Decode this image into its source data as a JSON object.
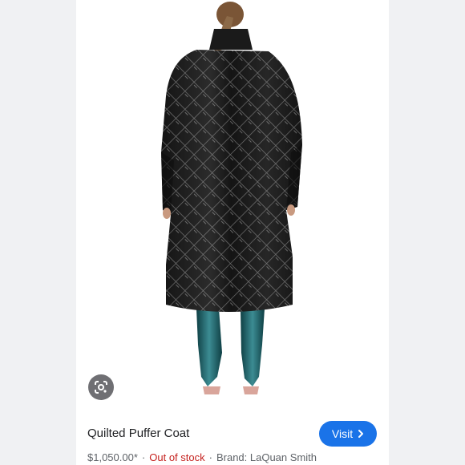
{
  "product": {
    "title": "Quilted Puffer Coat",
    "price": "$1,050.00*",
    "stock_status": "Out of stock",
    "separator": "·",
    "brand": "Brand: LaQuan Smith"
  },
  "actions": {
    "visit_label": "Visit",
    "visit_icon": "chevron-right-icon",
    "lens_icon": "google-lens-icon"
  },
  "colors": {
    "visit_bg": "#1a73e8",
    "out_of_stock": "#c5221f",
    "coat": "#151515",
    "boots": "#1e5a5f"
  }
}
